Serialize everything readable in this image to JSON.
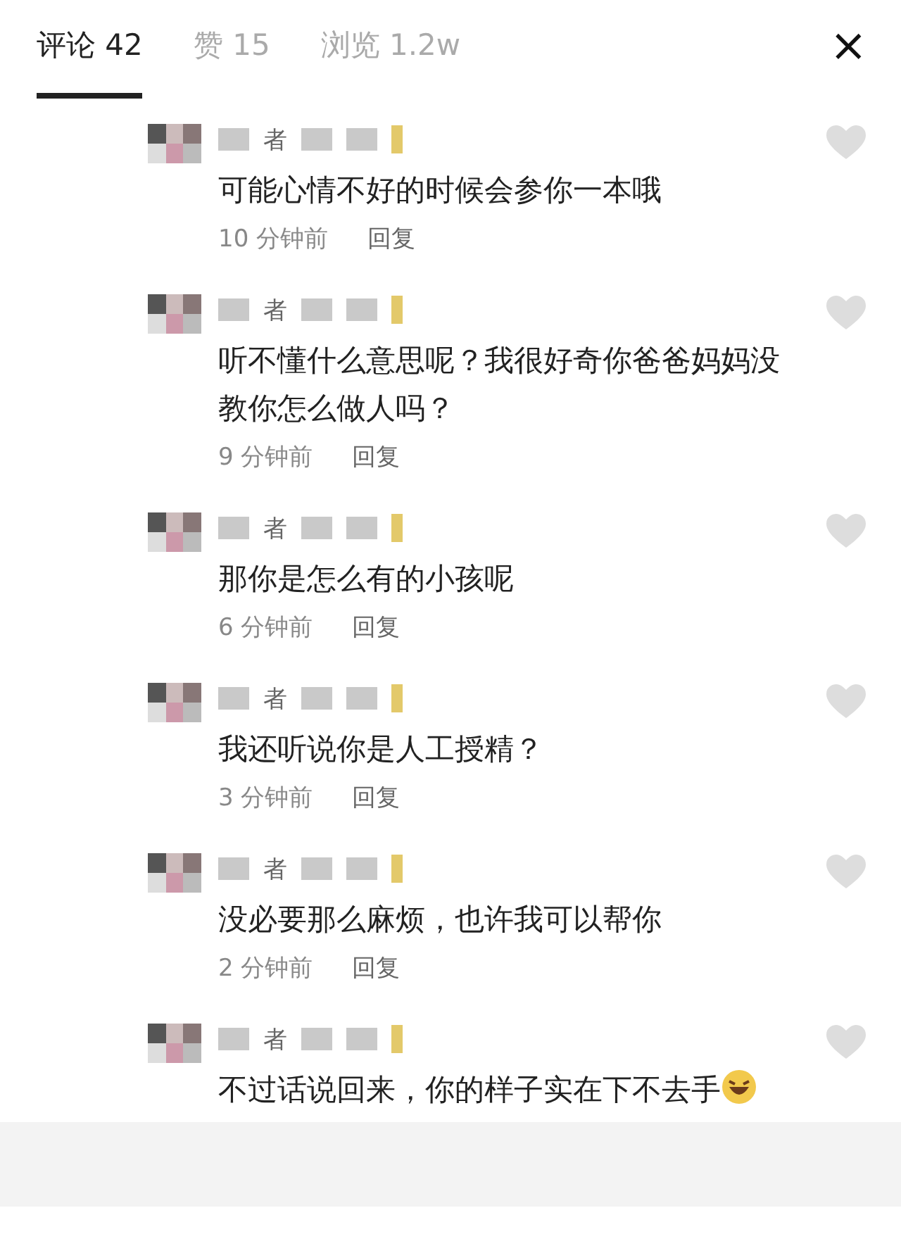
{
  "tabs": [
    {
      "label": "评论 42",
      "selected": true
    },
    {
      "label": "赞 15",
      "selected": false
    },
    {
      "label": "浏览 1.2w",
      "selected": false
    }
  ],
  "close": "×",
  "comments": [
    {
      "name_fragment": "者",
      "text": "可能心情不好的时候会参你一本哦",
      "time": "10 分钟前",
      "reply": "回复"
    },
    {
      "name_fragment": "者",
      "text": "听不懂什么意思呢？我很好奇你爸爸妈妈没教你怎么做人吗？",
      "time": "9 分钟前",
      "reply": "回复"
    },
    {
      "name_fragment": "者",
      "text": "那你是怎么有的小孩呢",
      "time": "6 分钟前",
      "reply": "回复"
    },
    {
      "name_fragment": "者",
      "text": "我还听说你是人工授精？",
      "time": "3 分钟前",
      "reply": "回复"
    },
    {
      "name_fragment": "者",
      "text": "没必要那么麻烦，也许我可以帮你",
      "time": "2 分钟前",
      "reply": "回复"
    },
    {
      "name_fragment": "者",
      "text": "不过话说回来，你的样子实在下不去手",
      "emoji": true
    }
  ]
}
